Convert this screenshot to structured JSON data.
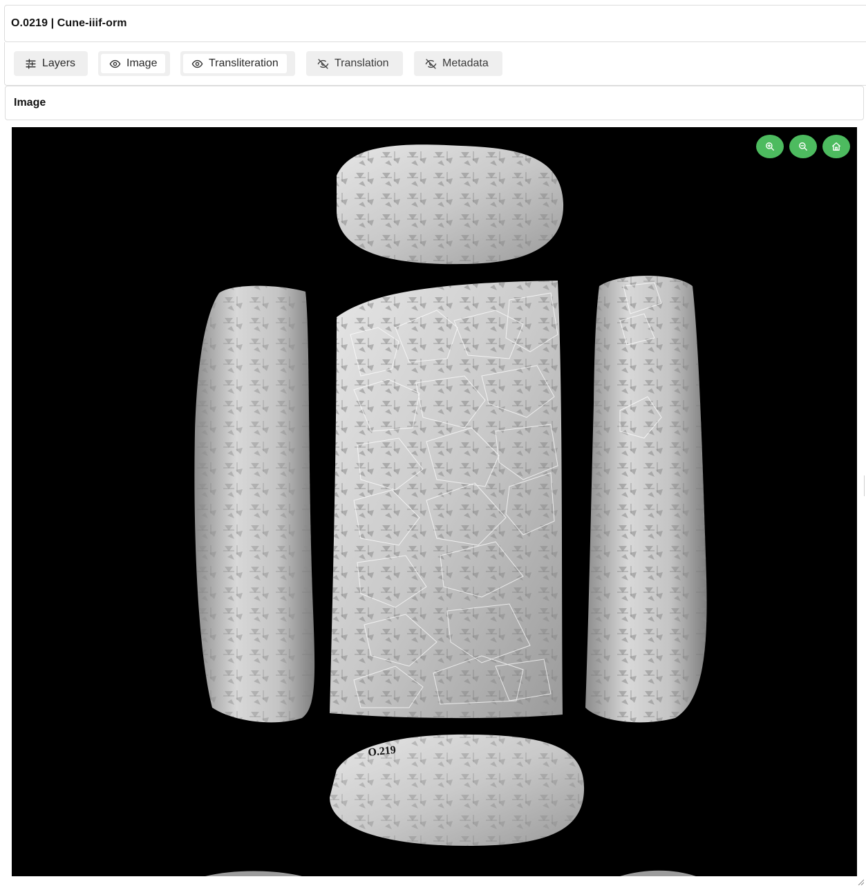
{
  "window": {
    "title": "O.0219 | Cune-iiif-orm"
  },
  "toolbar": {
    "buttons": [
      {
        "label": "Layers",
        "icon": "sliders-icon",
        "active": false
      },
      {
        "label": "Image",
        "icon": "eye-icon",
        "active": true
      },
      {
        "label": "Transliteration",
        "icon": "eye-icon",
        "active": true
      },
      {
        "label": "Translation",
        "icon": "eye-off-icon",
        "active": false
      },
      {
        "label": "Metadata",
        "icon": "eye-off-icon",
        "active": false
      }
    ]
  },
  "panel": {
    "title": "Image"
  },
  "viewer": {
    "controls": [
      {
        "name": "zoom-in",
        "icon": "zoom-in-icon"
      },
      {
        "name": "zoom-out",
        "icon": "zoom-out-icon"
      },
      {
        "name": "home",
        "icon": "home-icon"
      }
    ],
    "tablet_labels": {
      "bottom_edge": "O.219",
      "obverse": "O.219"
    },
    "colors": {
      "background": "#000000",
      "control": "#4dbb5f",
      "annotation": "#ffffff"
    }
  }
}
